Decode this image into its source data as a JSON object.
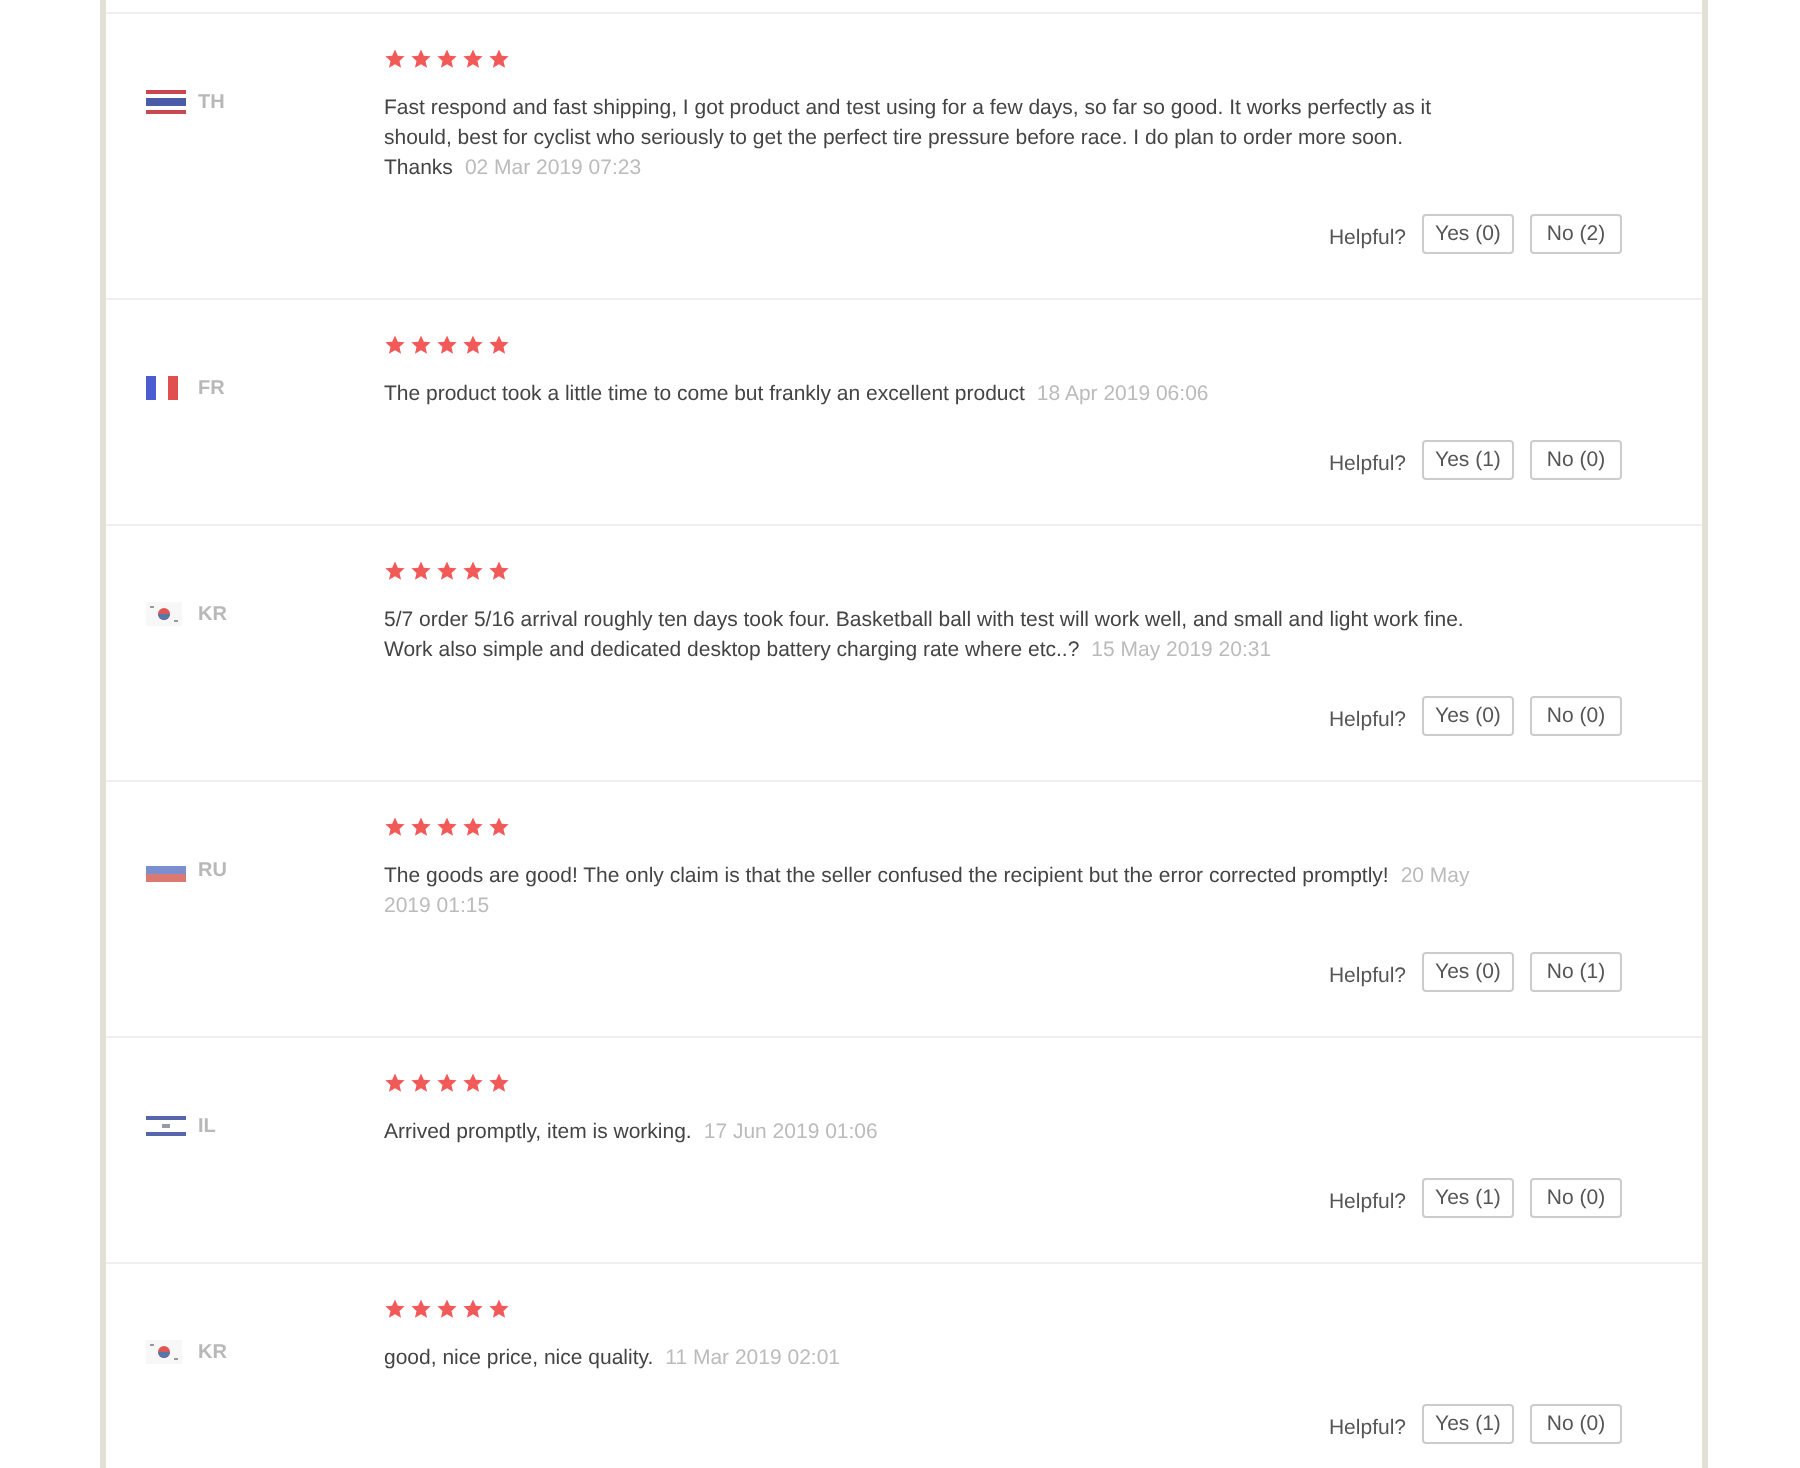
{
  "reviews": [
    {
      "kind": "th",
      "country": "TH",
      "stars": 5,
      "text": "Fast respond and fast shipping, I got product and test using for a few days, so far so good. It works perfectly as it should, best for cyclist who seriously to get the perfect tire pressure before race. I do plan to order more soon. Thanks",
      "date": "02 Mar 2019 07:23",
      "helpful_label": "Helpful?",
      "yes": "Yes (0)",
      "no": "No (2)"
    },
    {
      "kind": "fr",
      "country": "FR",
      "stars": 5,
      "text": "The product took a little time to come but frankly an excellent product",
      "date": "18 Apr 2019 06:06",
      "helpful_label": "Helpful?",
      "yes": "Yes (1)",
      "no": "No (0)"
    },
    {
      "kind": "kr",
      "country": "KR",
      "stars": 5,
      "text": "5/7 order 5/16 arrival roughly ten days took four. Basketball ball with test will work well, and small and light work fine. Work also simple and dedicated desktop battery charging rate where etc..?",
      "date": "15 May 2019 20:31",
      "helpful_label": "Helpful?",
      "yes": "Yes (0)",
      "no": "No (0)"
    },
    {
      "kind": "ru",
      "country": "RU",
      "stars": 5,
      "text": "The goods are good! The only claim is that the seller confused the recipient but the error corrected promptly!",
      "date": "20 May 2019 01:15",
      "helpful_label": "Helpful?",
      "yes": "Yes (0)",
      "no": "No (1)"
    },
    {
      "kind": "il",
      "country": "IL",
      "stars": 5,
      "text": "Arrived promptly, item is working.",
      "date": "17 Jun 2019 01:06",
      "helpful_label": "Helpful?",
      "yes": "Yes (1)",
      "no": "No (0)"
    },
    {
      "kind": "kr",
      "country": "KR",
      "stars": 5,
      "text": "good, nice price, nice quality.",
      "date": "11 Mar 2019 02:01",
      "helpful_label": "Helpful?",
      "yes": "Yes (1)",
      "no": "No (0)"
    }
  ]
}
